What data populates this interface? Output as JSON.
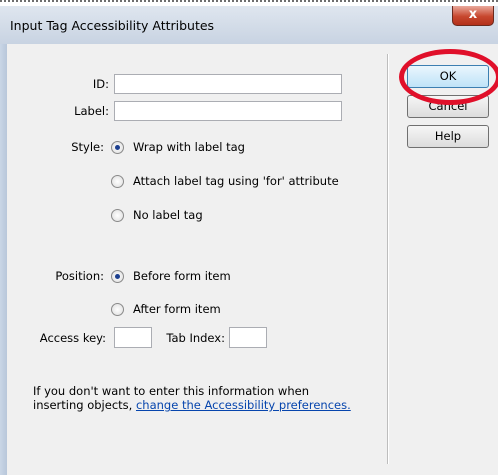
{
  "dialog": {
    "title": "Input Tag Accessibility Attributes",
    "close_glyph": "x"
  },
  "form": {
    "id_label": "ID:",
    "id_value": "",
    "label_label": "Label:",
    "label_value": "",
    "style_label": "Style:",
    "style_options": [
      {
        "label": "Wrap with label tag",
        "checked": true
      },
      {
        "label": "Attach label tag using 'for' attribute",
        "checked": false
      },
      {
        "label": "No label tag",
        "checked": false
      }
    ],
    "position_label": "Position:",
    "position_options": [
      {
        "label": "Before form item",
        "checked": true
      },
      {
        "label": "After form item",
        "checked": false
      }
    ],
    "access_key_label": "Access key:",
    "access_key_value": "",
    "tab_index_label": "Tab Index:",
    "tab_index_value": ""
  },
  "info": {
    "line1": "If you don't want to enter this information when",
    "line2_prefix": "inserting objects, ",
    "link_text": "change the Accessibility preferences."
  },
  "buttons": {
    "ok": "OK",
    "cancel": "Cancel",
    "help": "Help"
  },
  "colors": {
    "highlight_ring": "#e0102a",
    "link": "#0645ad"
  }
}
